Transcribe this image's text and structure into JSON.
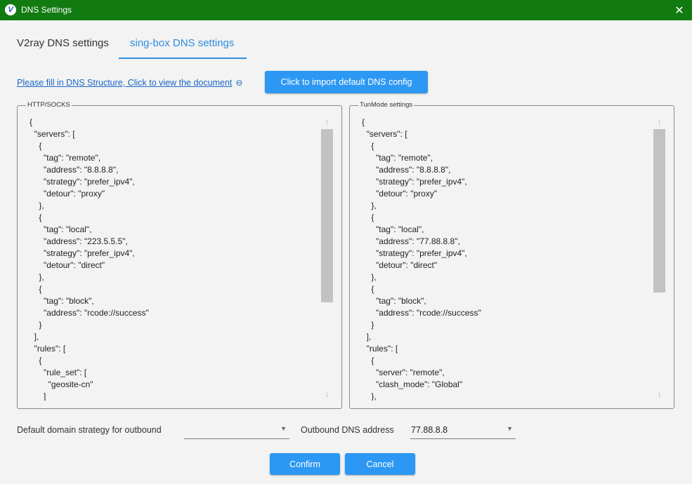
{
  "window": {
    "title": "DNS Settings",
    "app_icon_letter": "V",
    "close_glyph": "✕"
  },
  "tabs": [
    {
      "label": "V2ray DNS settings",
      "selected": false
    },
    {
      "label": "sing-box DNS settings",
      "selected": true
    }
  ],
  "doc_link": {
    "label": "Please fill in DNS Structure, Click to view the document",
    "icon": "link-icon"
  },
  "import_button": {
    "label": "Click to import default DNS config"
  },
  "http_socks": {
    "label": "HTTP/SOCKS",
    "text": "{\n  \"servers\": [\n    {\n      \"tag\": \"remote\",\n      \"address\": \"8.8.8.8\",\n      \"strategy\": \"prefer_ipv4\",\n      \"detour\": \"proxy\"\n    },\n    {\n      \"tag\": \"local\",\n      \"address\": \"223.5.5.5\",\n      \"strategy\": \"prefer_ipv4\",\n      \"detour\": \"direct\"\n    },\n    {\n      \"tag\": \"block\",\n      \"address\": \"rcode://success\"\n    }\n  ],\n  \"rules\": [\n    {\n      \"rule_set\": [\n        \"geosite-cn\"\n      ]"
  },
  "tun_mode": {
    "label": "TunMode settings",
    "text": "{\n  \"servers\": [\n    {\n      \"tag\": \"remote\",\n      \"address\": \"8.8.8.8\",\n      \"strategy\": \"prefer_ipv4\",\n      \"detour\": \"proxy\"\n    },\n    {\n      \"tag\": \"local\",\n      \"address\": \"77.88.8.8\",\n      \"strategy\": \"prefer_ipv4\",\n      \"detour\": \"direct\"\n    },\n    {\n      \"tag\": \"block\",\n      \"address\": \"rcode://success\"\n    }\n  ],\n  \"rules\": [\n    {\n      \"server\": \"remote\",\n      \"clash_mode\": \"Global\"\n    },"
  },
  "scroll": {
    "up_glyph": "↑",
    "down_glyph": "↓"
  },
  "domain_strategy": {
    "label": "Default domain strategy for outbound",
    "value": ""
  },
  "outbound_dns": {
    "label": "Outbound DNS address",
    "value": "77.88.8.8"
  },
  "combo_arrow": "▼",
  "buttons": {
    "confirm": "Confirm",
    "cancel": "Cancel"
  },
  "colors": {
    "titlebar": "#117a11",
    "accent": "#2d98f3",
    "tab_active": "#2b8de0"
  }
}
